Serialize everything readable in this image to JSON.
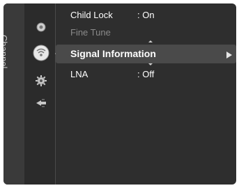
{
  "menu": {
    "category_label": "Channel",
    "items": [
      {
        "label": "Child Lock",
        "value": ": On"
      },
      {
        "label": "Fine Tune",
        "value": ""
      },
      {
        "label": "Signal Information",
        "value": ""
      },
      {
        "label": "LNA",
        "value": ": Off"
      }
    ],
    "selected_index": 2
  },
  "icons": [
    "picture-icon",
    "channel-icon",
    "setup-icon",
    "input-icon"
  ]
}
